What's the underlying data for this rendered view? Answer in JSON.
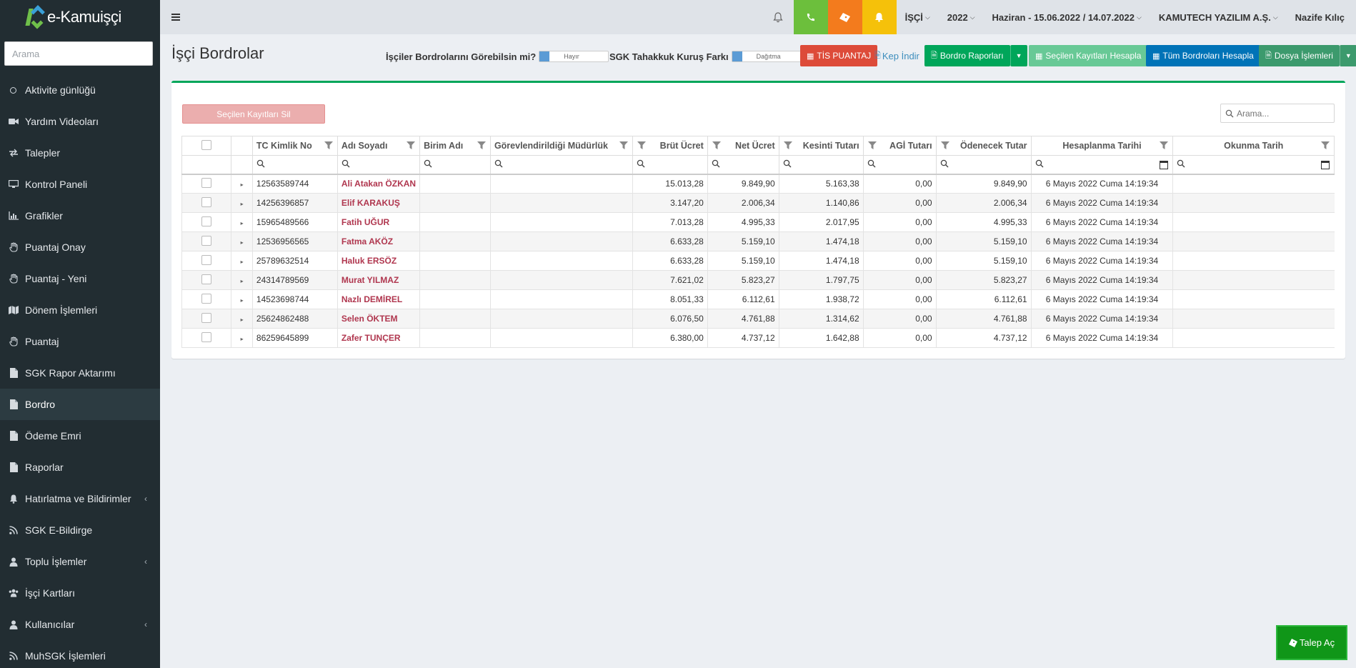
{
  "app": {
    "logo_text": "e-Kamuişçi"
  },
  "sidebar": {
    "search_placeholder": "Arama",
    "items": [
      {
        "label": "Aktivite günlüğü",
        "icon": "circle-icon"
      },
      {
        "label": "Yardım Videoları",
        "icon": "video-icon"
      },
      {
        "label": "Talepler",
        "icon": "exchange-icon"
      },
      {
        "label": "Kontrol Paneli",
        "icon": "desktop-icon"
      },
      {
        "label": "Grafikler",
        "icon": "bar-chart-icon"
      },
      {
        "label": "Puantaj Onay",
        "icon": "hand-icon"
      },
      {
        "label": "Puantaj - Yeni",
        "icon": "hand-icon"
      },
      {
        "label": "Dönem İşlemleri",
        "icon": "map-icon"
      },
      {
        "label": "Puantaj",
        "icon": "hand-icon"
      },
      {
        "label": "SGK Rapor Aktarımı",
        "icon": "file-icon"
      },
      {
        "label": "Bordro",
        "icon": "file-icon"
      },
      {
        "label": "Ödeme Emri",
        "icon": "file-icon"
      },
      {
        "label": "Raporlar",
        "icon": "file-icon"
      },
      {
        "label": "Hatırlatma ve Bildirimler",
        "icon": "bell-icon"
      },
      {
        "label": "SGK E-Bildirge",
        "icon": "rss-icon"
      },
      {
        "label": "Toplu İşlemler",
        "icon": "user-icon"
      },
      {
        "label": "İşçi Kartları",
        "icon": "users-icon"
      },
      {
        "label": "Kullanıcılar",
        "icon": "user-icon"
      },
      {
        "label": "MuhSGK İşlemleri",
        "icon": "rss-icon"
      }
    ]
  },
  "topbar": {
    "role": "İŞÇİ",
    "year": "2022",
    "period": "Haziran - 15.06.2022 / 14.07.2022",
    "company": "KAMUTECH YAZILIM A.Ş.",
    "user": "Nazife Kılıç",
    "colors": {
      "phone": "#6cbf3c",
      "tag": "#f37b1d",
      "bell": "#f5c10a"
    }
  },
  "page": {
    "title": "İşçi Bordrolar",
    "toggle1_label": "İşçiler Bordrolarını Görebilsin mi?",
    "toggle1_value": "Hayır",
    "toggle2_label": "SGK Tahakkuk Kuruş Farkı",
    "toggle2_value": "Dağıtma",
    "btn_tis": "TİS PUANTAJ",
    "btn_kep": "Kep İndir",
    "btn_bordro_rapor": "Bordro Raporları",
    "btn_secilen_hesapla": "Seçilen Kayıtları Hesapla",
    "btn_tum_hesapla": "Tüm Bordroları Hesapla",
    "btn_dosya": "Dosya İşlemleri",
    "btn_delete": "Seçilen Kayıtları Sil",
    "grid_search_placeholder": "Arama..."
  },
  "table": {
    "columns": [
      "TC Kimlik No",
      "Adı Soyadı",
      "Birim Adı",
      "Görevlendirildiği Müdürlük",
      "Brüt Ücret",
      "Net Ücret",
      "Kesinti Tutarı",
      "AGİ Tutarı",
      "Ödenecek Tutar",
      "Hesaplanma Tarihi",
      "Okunma Tarih"
    ],
    "rows": [
      {
        "tc": "12563589744",
        "name": "Ali Atakan ÖZKAN",
        "birim": "",
        "mudurluk": "",
        "brut": "15.013,28",
        "net": "9.849,90",
        "kesinti": "5.163,38",
        "agi": "0,00",
        "odenecek": "9.849,90",
        "tarih": "6 Mayıs 2022 Cuma 14:19:34",
        "okunma": ""
      },
      {
        "tc": "14256396857",
        "name": "Elif KARAKUŞ",
        "birim": "",
        "mudurluk": "",
        "brut": "3.147,20",
        "net": "2.006,34",
        "kesinti": "1.140,86",
        "agi": "0,00",
        "odenecek": "2.006,34",
        "tarih": "6 Mayıs 2022 Cuma 14:19:34",
        "okunma": ""
      },
      {
        "tc": "15965489566",
        "name": "Fatih UĞUR",
        "birim": "",
        "mudurluk": "",
        "brut": "7.013,28",
        "net": "4.995,33",
        "kesinti": "2.017,95",
        "agi": "0,00",
        "odenecek": "4.995,33",
        "tarih": "6 Mayıs 2022 Cuma 14:19:34",
        "okunma": ""
      },
      {
        "tc": "12536956565",
        "name": "Fatma AKÖZ",
        "birim": "",
        "mudurluk": "",
        "brut": "6.633,28",
        "net": "5.159,10",
        "kesinti": "1.474,18",
        "agi": "0,00",
        "odenecek": "5.159,10",
        "tarih": "6 Mayıs 2022 Cuma 14:19:34",
        "okunma": ""
      },
      {
        "tc": "25789632514",
        "name": "Haluk ERSÖZ",
        "birim": "",
        "mudurluk": "",
        "brut": "6.633,28",
        "net": "5.159,10",
        "kesinti": "1.474,18",
        "agi": "0,00",
        "odenecek": "5.159,10",
        "tarih": "6 Mayıs 2022 Cuma 14:19:34",
        "okunma": ""
      },
      {
        "tc": "24314789569",
        "name": "Murat YILMAZ",
        "birim": "",
        "mudurluk": "",
        "brut": "7.621,02",
        "net": "5.823,27",
        "kesinti": "1.797,75",
        "agi": "0,00",
        "odenecek": "5.823,27",
        "tarih": "6 Mayıs 2022 Cuma 14:19:34",
        "okunma": ""
      },
      {
        "tc": "14523698744",
        "name": "Nazlı DEMİREL",
        "birim": "",
        "mudurluk": "",
        "brut": "8.051,33",
        "net": "6.112,61",
        "kesinti": "1.938,72",
        "agi": "0,00",
        "odenecek": "6.112,61",
        "tarih": "6 Mayıs 2022 Cuma 14:19:34",
        "okunma": ""
      },
      {
        "tc": "25624862488",
        "name": "Selen ÖKTEM",
        "birim": "",
        "mudurluk": "",
        "brut": "6.076,50",
        "net": "4.761,88",
        "kesinti": "1.314,62",
        "agi": "0,00",
        "odenecek": "4.761,88",
        "tarih": "6 Mayıs 2022 Cuma 14:19:34",
        "okunma": ""
      },
      {
        "tc": "86259645899",
        "name": "Zafer TUNÇER",
        "birim": "",
        "mudurluk": "",
        "brut": "6.380,00",
        "net": "4.737,12",
        "kesinti": "1.642,88",
        "agi": "0,00",
        "odenecek": "4.737,12",
        "tarih": "6 Mayıs 2022 Cuma 14:19:34",
        "okunma": ""
      }
    ]
  },
  "talep_button": "Talep Aç"
}
